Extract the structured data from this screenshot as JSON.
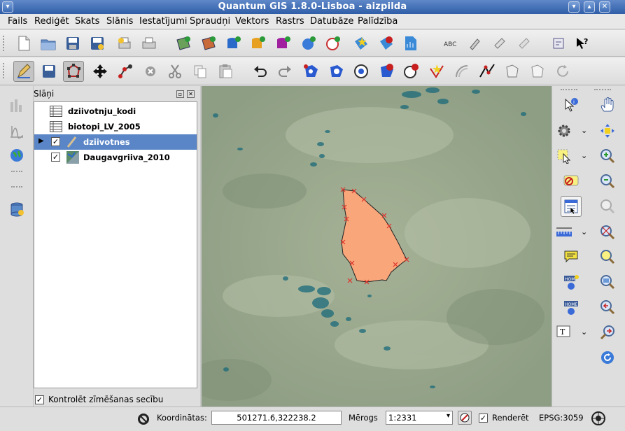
{
  "window": {
    "title": "Quantum GIS 1.8.0-Lisboa - aizpilda",
    "close_label": "✕"
  },
  "menu": [
    "Fails",
    "Rediģēt",
    "Skats",
    "Slānis",
    "Iestatījumi",
    "Spraudņi",
    "Vektors",
    "Rastrs",
    "Datubāze",
    "Palīdzība"
  ],
  "toolbar_file": [
    "new-project-icon",
    "open-project-icon",
    "save-project-icon",
    "save-as-icon",
    "print-composer-icon",
    "print-icon",
    "add-raster-icon",
    "add-raster-rgb-icon",
    "add-vector-icon",
    "add-postgis-icon",
    "add-spatialite-icon",
    "add-wms-icon",
    "add-wfs-icon",
    "add-delimited-icon",
    "remove-layer-icon",
    "new-shapefile-icon",
    "label-icon",
    "move-label-icon",
    "rotate-label-icon",
    "change-label-icon",
    "python-console-icon",
    "whats-this-icon"
  ],
  "toolbar_edit": [
    "toggle-edit-icon",
    "save-edits-icon",
    "node-tool-icon",
    "move-feature-icon",
    "add-part-icon",
    "delete-selected-icon",
    "cut-icon",
    "copy-icon",
    "paste-icon",
    "undo-icon",
    "redo-icon",
    "add-ring-icon",
    "add-part-polygon-icon",
    "fill-ring-icon",
    "delete-ring-icon",
    "delete-part-icon",
    "reshape-icon",
    "offset-curve-icon",
    "split-icon",
    "merge-icon",
    "merge-attributes-icon",
    "rotate-point-icon"
  ],
  "layers_panel": {
    "title": "Slāņi",
    "layers": [
      {
        "name": "dziivotnju_kodi",
        "type": "table",
        "checked": null,
        "selected": false
      },
      {
        "name": "biotopi_LV_2005",
        "type": "table",
        "checked": null,
        "selected": false
      },
      {
        "name": "dziivotnes",
        "type": "vector",
        "checked": true,
        "selected": true
      },
      {
        "name": "Daugavgriiva_2010",
        "type": "raster",
        "checked": true,
        "selected": false
      }
    ],
    "render_order_label": "Kontrolēt zīmēšanas secību",
    "render_order_checked": true
  },
  "status": {
    "coords_label": "Koordinātas:",
    "coords_value": "501271.6,322238.2",
    "scale_label": "Mērogs",
    "scale_value": "1:2331",
    "render_label": "Renderēt",
    "render_checked": true,
    "crs": "EPSG:3059"
  },
  "colors": {
    "polygon_fill": "#f8a67a",
    "vertex_marker": "#e0302a",
    "selection": "#5a86c8"
  }
}
